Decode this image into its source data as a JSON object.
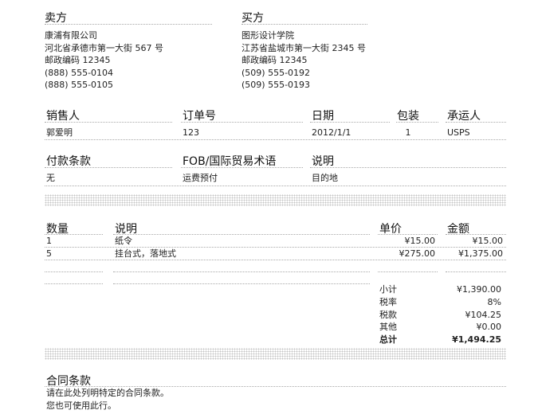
{
  "seller": {
    "heading": "卖方",
    "lines": [
      "康浦有限公司",
      "河北省承德市第一大街 567 号",
      "邮政编码 12345",
      "(888) 555-0104",
      "(888) 555-0105"
    ]
  },
  "buyer": {
    "heading": "买方",
    "lines": [
      "图形设计学院",
      "江苏省盐城市第一大街 2345 号",
      "邮政编码 12345",
      "(509) 555-0192",
      "(509) 555-0193"
    ]
  },
  "order_info": {
    "salesperson_label": "销售人",
    "salesperson": "郭爱明",
    "order_no_label": "订单号",
    "order_no": "123",
    "date_label": "日期",
    "date": "2012/1/1",
    "package_label": "包装",
    "package": "1",
    "carrier_label": "承运人",
    "carrier": "USPS"
  },
  "terms_info": {
    "payment_label": "付款条款",
    "payment": "无",
    "fob_label": "FOB/国际贸易术语",
    "fob": "运费预付",
    "notes_label": "说明",
    "notes": "目的地"
  },
  "items": {
    "qty_label": "数量",
    "desc_label": "说明",
    "price_label": "单价",
    "amount_label": "金额",
    "rows": [
      {
        "qty": "1",
        "desc": "纸令",
        "price": "¥15.00",
        "amount": "¥15.00"
      },
      {
        "qty": "5",
        "desc": "挂台式，落地式",
        "price": "¥275.00",
        "amount": "¥1,375.00"
      }
    ]
  },
  "totals": {
    "subtotal_label": "小计",
    "subtotal": "¥1,390.00",
    "tax_rate_label": "税率",
    "tax_rate": "8%",
    "tax_label": "税款",
    "tax": "¥104.25",
    "other_label": "其他",
    "other": "¥0.00",
    "total_label": "总计",
    "total": "¥1,494.25"
  },
  "contract": {
    "heading": "合同条款",
    "line1": "请在此处列明特定的合同条款。",
    "line2": "您也可使用此行。"
  }
}
